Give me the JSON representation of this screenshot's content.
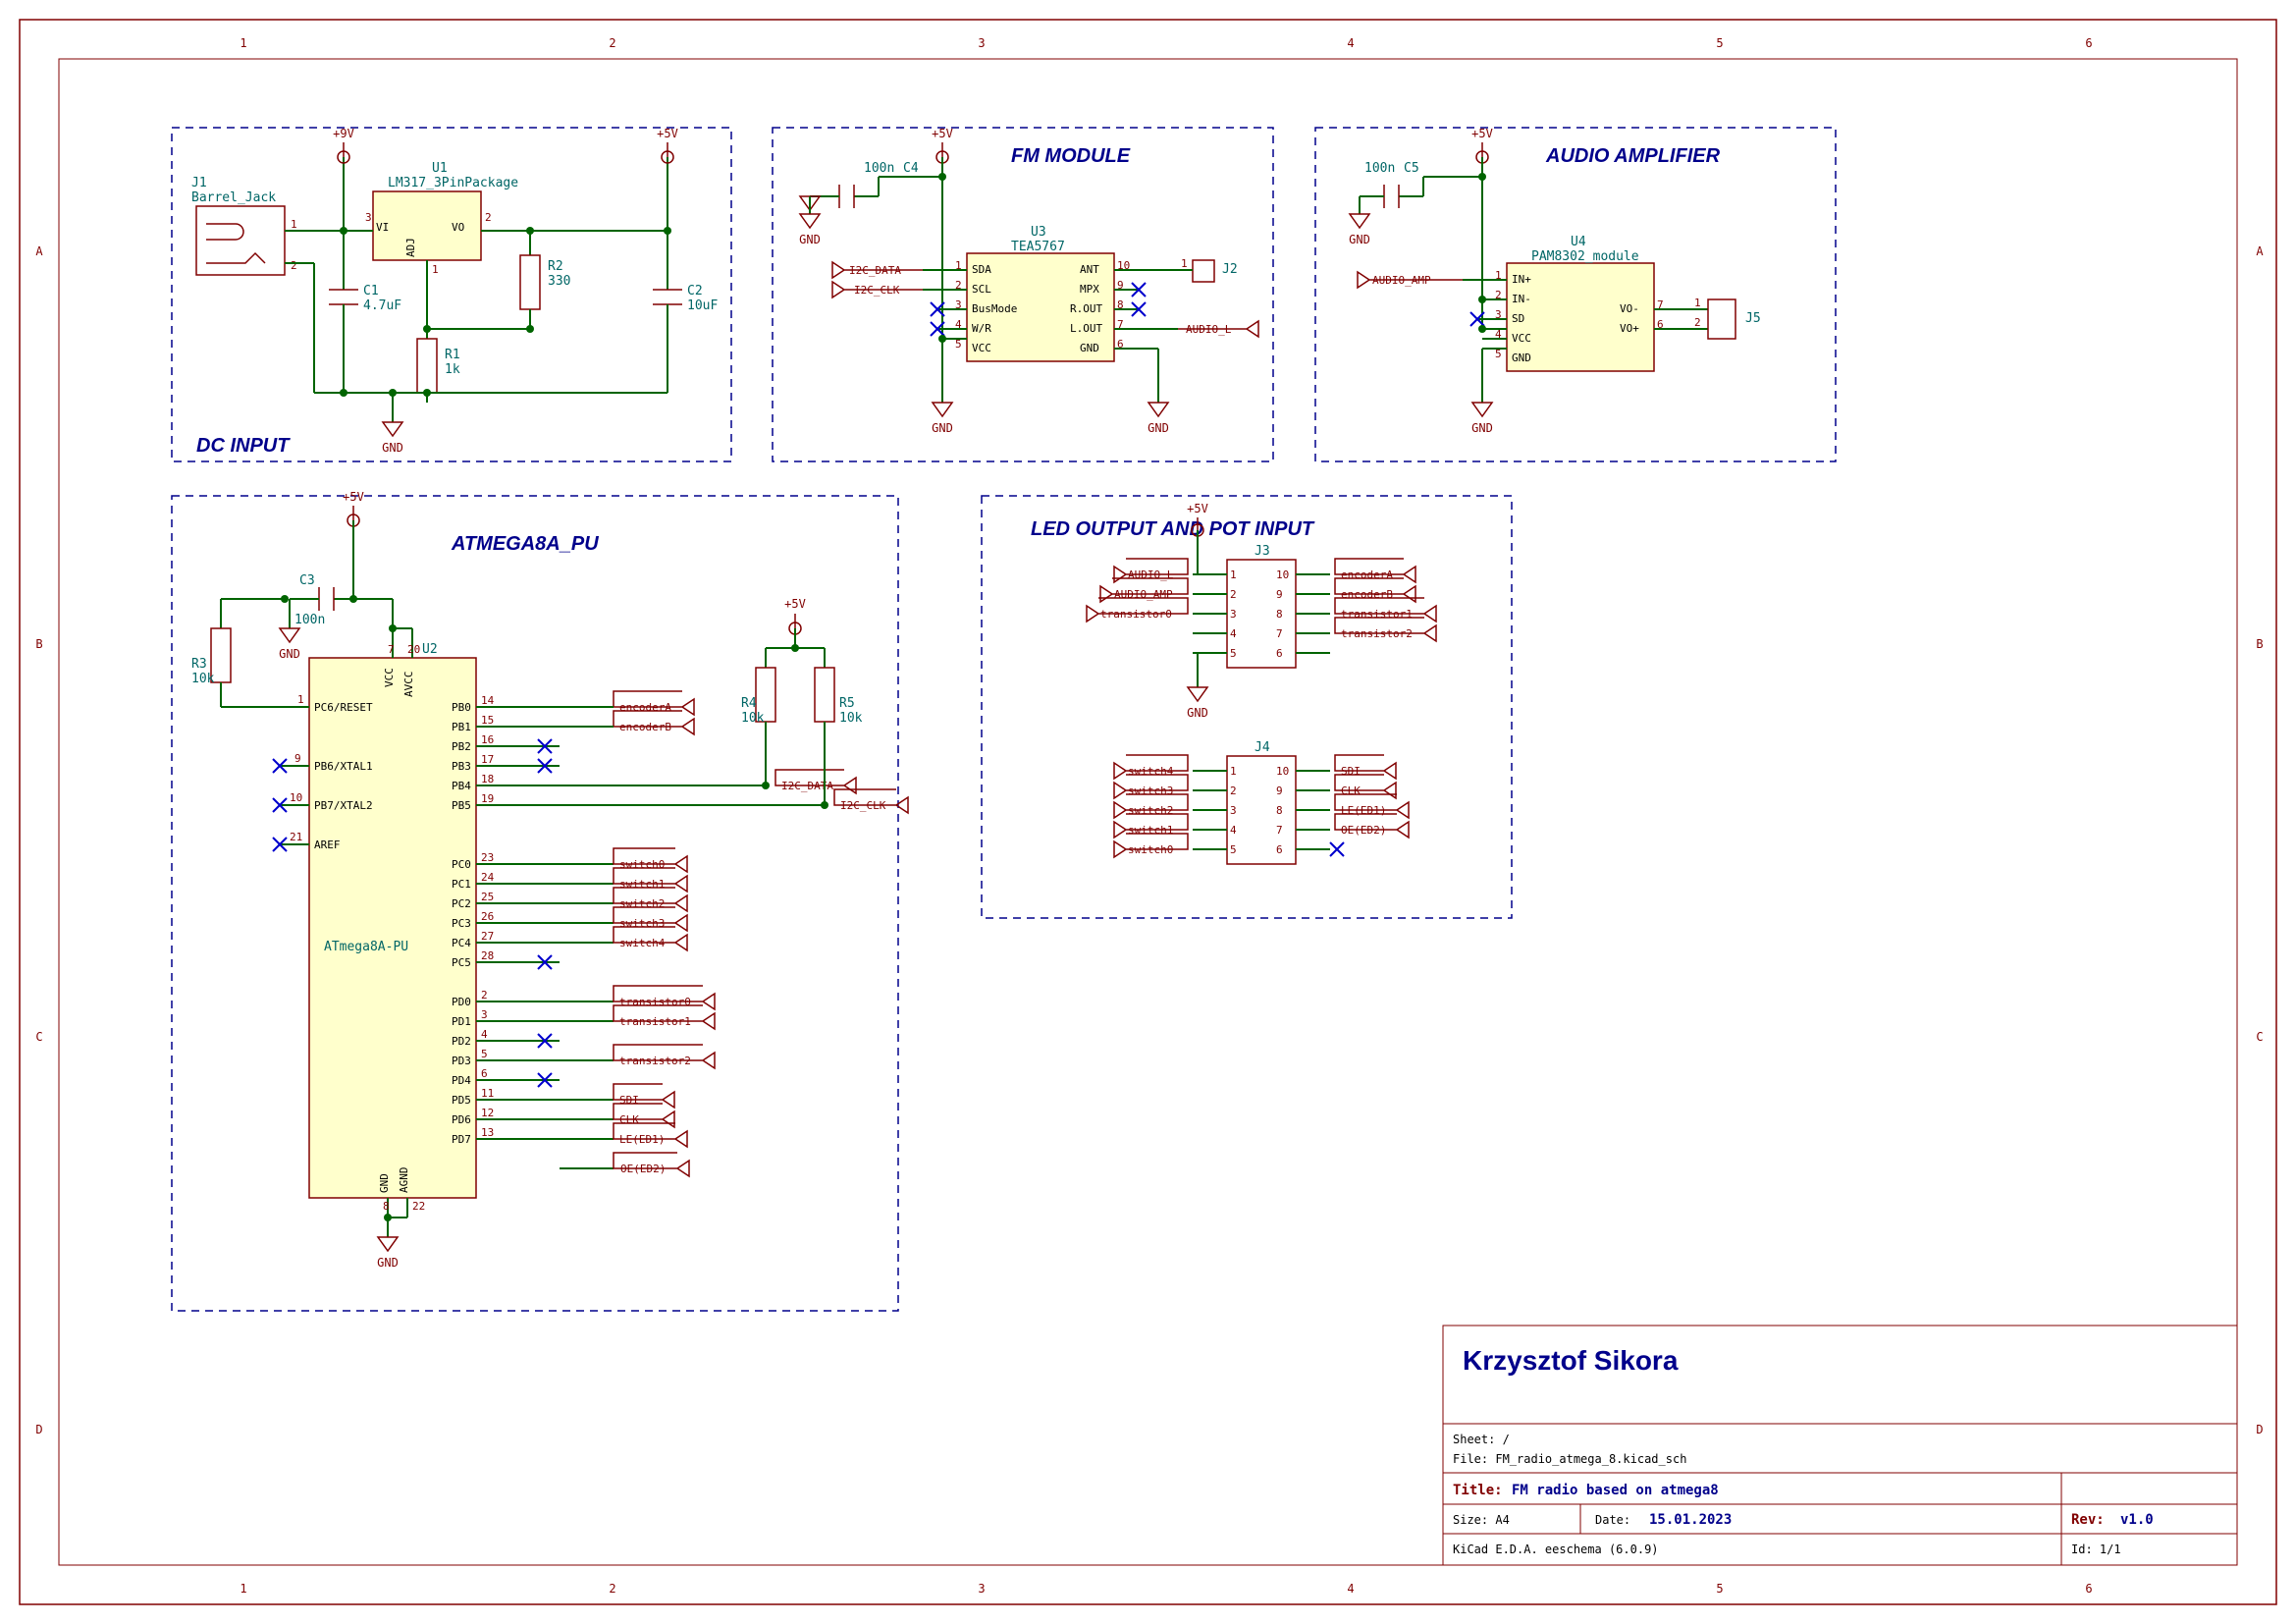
{
  "frame": {
    "ruler_top": [
      "1",
      "2",
      "3",
      "4",
      "5",
      "6"
    ],
    "ruler_side": [
      "A",
      "B",
      "C",
      "D"
    ]
  },
  "blocks": {
    "dc": "DC INPUT",
    "fm": "FM MODULE",
    "amp": "AUDIO AMPLIFIER",
    "mcu": "ATMEGA8A_PU",
    "led": "LED OUTPUT AND POT INPUT"
  },
  "power": {
    "p9v": "+9V",
    "p5v": "+5V",
    "gnd": "GND"
  },
  "dc": {
    "j1": {
      "ref": "J1",
      "val": "Barrel_Jack"
    },
    "u1": {
      "ref": "U1",
      "val": "LM317_3PinPackage",
      "pins": {
        "vi": "VI",
        "vo": "VO",
        "adj": "ADJ"
      },
      "nums": {
        "vi": "3",
        "vo": "2",
        "adj": "1"
      }
    },
    "c1": {
      "ref": "C1",
      "val": "4.7uF"
    },
    "c2": {
      "ref": "C2",
      "val": "10uF"
    },
    "r1": {
      "ref": "R1",
      "val": "1k"
    },
    "r2": {
      "ref": "R2",
      "val": "330"
    }
  },
  "fm": {
    "c4": {
      "ref": "C4",
      "val": "100n"
    },
    "u3": {
      "ref": "U3",
      "val": "TEA5767",
      "left": [
        "SDA",
        "SCL",
        "BusMode",
        "W/R",
        "VCC"
      ],
      "right": [
        "ANT",
        "MPX",
        "R.OUT",
        "L.OUT",
        "GND"
      ],
      "lnum": [
        "1",
        "2",
        "3",
        "4",
        "5"
      ],
      "rnum": [
        "10",
        "9",
        "8",
        "7",
        "6"
      ]
    },
    "j2": {
      "ref": "J2"
    },
    "audio_l": "AUDIO_L",
    "i2c_data": "I2C_DATA",
    "i2c_clk": "I2C_CLK"
  },
  "amp": {
    "c5": {
      "ref": "C5",
      "val": "100n"
    },
    "u4": {
      "ref": "U4",
      "val": "PAM8302_module",
      "left": [
        "IN+",
        "IN-",
        "SD",
        "VCC",
        "GND"
      ],
      "right": [
        "VO-",
        "VO+"
      ],
      "lnum": [
        "1",
        "2",
        "3",
        "4",
        "5"
      ],
      "rnum": [
        "7",
        "6"
      ]
    },
    "j5": {
      "ref": "J5"
    },
    "audio_amp": "AUDIO_AMP"
  },
  "mcu": {
    "u2": {
      "ref": "U2",
      "val": "ATmega8A-PU"
    },
    "c3": {
      "ref": "C3",
      "val": "100n"
    },
    "r3": {
      "ref": "R3",
      "val": "10k"
    },
    "r4": {
      "ref": "R4",
      "val": "10k"
    },
    "r5": {
      "ref": "R5",
      "val": "10k"
    },
    "pins_left": [
      {
        "n": "1",
        "t": "PC6/RESET"
      },
      {
        "n": "9",
        "t": "PB6/XTAL1"
      },
      {
        "n": "10",
        "t": "PB7/XTAL2"
      },
      {
        "n": "21",
        "t": "AREF"
      }
    ],
    "pins_top": [
      {
        "n": "7",
        "t": "VCC"
      },
      {
        "n": "20",
        "t": "AVCC"
      }
    ],
    "pins_bot": [
      {
        "n": "8",
        "t": "GND"
      },
      {
        "n": "22",
        "t": "AGND"
      }
    ],
    "pb": [
      {
        "n": "14",
        "t": "PB0",
        "net": "encoderA"
      },
      {
        "n": "15",
        "t": "PB1",
        "net": "encoderB"
      },
      {
        "n": "16",
        "t": "PB2",
        "net": ""
      },
      {
        "n": "17",
        "t": "PB3",
        "net": ""
      },
      {
        "n": "18",
        "t": "PB4",
        "net": "I2C_DATA"
      },
      {
        "n": "19",
        "t": "PB5",
        "net": "I2C_CLK"
      }
    ],
    "pc": [
      {
        "n": "23",
        "t": "PC0",
        "net": "switch0"
      },
      {
        "n": "24",
        "t": "PC1",
        "net": "switch1"
      },
      {
        "n": "25",
        "t": "PC2",
        "net": "switch2"
      },
      {
        "n": "26",
        "t": "PC3",
        "net": "switch3"
      },
      {
        "n": "27",
        "t": "PC4",
        "net": "switch4"
      },
      {
        "n": "28",
        "t": "PC5",
        "net": ""
      }
    ],
    "pd": [
      {
        "n": "2",
        "t": "PD0",
        "net": "transistor0"
      },
      {
        "n": "3",
        "t": "PD1",
        "net": "transistor1"
      },
      {
        "n": "4",
        "t": "PD2",
        "net": ""
      },
      {
        "n": "5",
        "t": "PD3",
        "net": "transistor2"
      },
      {
        "n": "6",
        "t": "PD4",
        "net": ""
      },
      {
        "n": "11",
        "t": "PD5",
        "net": "SDI"
      },
      {
        "n": "12",
        "t": "PD6",
        "net": "CLK"
      },
      {
        "n": "13",
        "t": "PD7",
        "net": "LE(ED1)"
      }
    ],
    "oe": "OE(ED2)"
  },
  "led": {
    "j3": {
      "ref": "J3",
      "left": [
        "AUDIO_L",
        "AUDIO_AMP",
        "transistor0",
        ""
      ],
      "right": [
        "encoderA",
        "encoderB",
        "transistor1",
        "transistor2"
      ],
      "lnum": [
        "1",
        "2",
        "3",
        "4",
        "5"
      ],
      "rnum": [
        "10",
        "9",
        "8",
        "7",
        "6"
      ]
    },
    "j4": {
      "ref": "J4",
      "left": [
        "switch4",
        "switch3",
        "switch2",
        "switch1",
        "switch0"
      ],
      "right": [
        "SDI",
        "CLK",
        "LE(ED1)",
        "OE(ED2)"
      ],
      "lnum": [
        "1",
        "2",
        "3",
        "4",
        "5"
      ],
      "rnum": [
        "10",
        "9",
        "8",
        "7",
        "6"
      ]
    }
  },
  "titleblock": {
    "author": "Krzysztof Sikora",
    "sheet_lbl": "Sheet:",
    "sheet_val": "/",
    "file_lbl": "File:",
    "file_val": "FM_radio_atmega_8.kicad_sch",
    "title_lbl": "Title:",
    "title_val": "FM radio based on atmega8",
    "size_lbl": "Size:",
    "size_val": "A4",
    "date_lbl": "Date:",
    "date_val": "15.01.2023",
    "rev_lbl": "Rev:",
    "rev_val": "v1.0",
    "gen": "KiCad E.D.A.  eeschema (6.0.9)",
    "id_lbl": "Id:",
    "id_val": "1/1"
  }
}
